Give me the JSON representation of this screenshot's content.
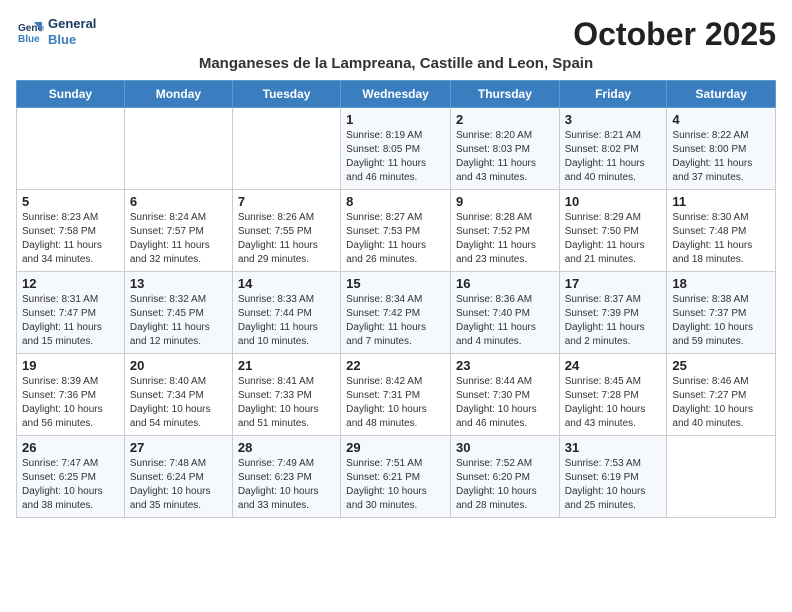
{
  "logo": {
    "line1": "General",
    "line2": "Blue"
  },
  "title": "October 2025",
  "subtitle": "Manganeses de la Lampreana, Castille and Leon, Spain",
  "weekdays": [
    "Sunday",
    "Monday",
    "Tuesday",
    "Wednesday",
    "Thursday",
    "Friday",
    "Saturday"
  ],
  "weeks": [
    [
      {
        "day": "",
        "info": ""
      },
      {
        "day": "",
        "info": ""
      },
      {
        "day": "",
        "info": ""
      },
      {
        "day": "1",
        "info": "Sunrise: 8:19 AM\nSunset: 8:05 PM\nDaylight: 11 hours\nand 46 minutes."
      },
      {
        "day": "2",
        "info": "Sunrise: 8:20 AM\nSunset: 8:03 PM\nDaylight: 11 hours\nand 43 minutes."
      },
      {
        "day": "3",
        "info": "Sunrise: 8:21 AM\nSunset: 8:02 PM\nDaylight: 11 hours\nand 40 minutes."
      },
      {
        "day": "4",
        "info": "Sunrise: 8:22 AM\nSunset: 8:00 PM\nDaylight: 11 hours\nand 37 minutes."
      }
    ],
    [
      {
        "day": "5",
        "info": "Sunrise: 8:23 AM\nSunset: 7:58 PM\nDaylight: 11 hours\nand 34 minutes."
      },
      {
        "day": "6",
        "info": "Sunrise: 8:24 AM\nSunset: 7:57 PM\nDaylight: 11 hours\nand 32 minutes."
      },
      {
        "day": "7",
        "info": "Sunrise: 8:26 AM\nSunset: 7:55 PM\nDaylight: 11 hours\nand 29 minutes."
      },
      {
        "day": "8",
        "info": "Sunrise: 8:27 AM\nSunset: 7:53 PM\nDaylight: 11 hours\nand 26 minutes."
      },
      {
        "day": "9",
        "info": "Sunrise: 8:28 AM\nSunset: 7:52 PM\nDaylight: 11 hours\nand 23 minutes."
      },
      {
        "day": "10",
        "info": "Sunrise: 8:29 AM\nSunset: 7:50 PM\nDaylight: 11 hours\nand 21 minutes."
      },
      {
        "day": "11",
        "info": "Sunrise: 8:30 AM\nSunset: 7:48 PM\nDaylight: 11 hours\nand 18 minutes."
      }
    ],
    [
      {
        "day": "12",
        "info": "Sunrise: 8:31 AM\nSunset: 7:47 PM\nDaylight: 11 hours\nand 15 minutes."
      },
      {
        "day": "13",
        "info": "Sunrise: 8:32 AM\nSunset: 7:45 PM\nDaylight: 11 hours\nand 12 minutes."
      },
      {
        "day": "14",
        "info": "Sunrise: 8:33 AM\nSunset: 7:44 PM\nDaylight: 11 hours\nand 10 minutes."
      },
      {
        "day": "15",
        "info": "Sunrise: 8:34 AM\nSunset: 7:42 PM\nDaylight: 11 hours\nand 7 minutes."
      },
      {
        "day": "16",
        "info": "Sunrise: 8:36 AM\nSunset: 7:40 PM\nDaylight: 11 hours\nand 4 minutes."
      },
      {
        "day": "17",
        "info": "Sunrise: 8:37 AM\nSunset: 7:39 PM\nDaylight: 11 hours\nand 2 minutes."
      },
      {
        "day": "18",
        "info": "Sunrise: 8:38 AM\nSunset: 7:37 PM\nDaylight: 10 hours\nand 59 minutes."
      }
    ],
    [
      {
        "day": "19",
        "info": "Sunrise: 8:39 AM\nSunset: 7:36 PM\nDaylight: 10 hours\nand 56 minutes."
      },
      {
        "day": "20",
        "info": "Sunrise: 8:40 AM\nSunset: 7:34 PM\nDaylight: 10 hours\nand 54 minutes."
      },
      {
        "day": "21",
        "info": "Sunrise: 8:41 AM\nSunset: 7:33 PM\nDaylight: 10 hours\nand 51 minutes."
      },
      {
        "day": "22",
        "info": "Sunrise: 8:42 AM\nSunset: 7:31 PM\nDaylight: 10 hours\nand 48 minutes."
      },
      {
        "day": "23",
        "info": "Sunrise: 8:44 AM\nSunset: 7:30 PM\nDaylight: 10 hours\nand 46 minutes."
      },
      {
        "day": "24",
        "info": "Sunrise: 8:45 AM\nSunset: 7:28 PM\nDaylight: 10 hours\nand 43 minutes."
      },
      {
        "day": "25",
        "info": "Sunrise: 8:46 AM\nSunset: 7:27 PM\nDaylight: 10 hours\nand 40 minutes."
      }
    ],
    [
      {
        "day": "26",
        "info": "Sunrise: 7:47 AM\nSunset: 6:25 PM\nDaylight: 10 hours\nand 38 minutes."
      },
      {
        "day": "27",
        "info": "Sunrise: 7:48 AM\nSunset: 6:24 PM\nDaylight: 10 hours\nand 35 minutes."
      },
      {
        "day": "28",
        "info": "Sunrise: 7:49 AM\nSunset: 6:23 PM\nDaylight: 10 hours\nand 33 minutes."
      },
      {
        "day": "29",
        "info": "Sunrise: 7:51 AM\nSunset: 6:21 PM\nDaylight: 10 hours\nand 30 minutes."
      },
      {
        "day": "30",
        "info": "Sunrise: 7:52 AM\nSunset: 6:20 PM\nDaylight: 10 hours\nand 28 minutes."
      },
      {
        "day": "31",
        "info": "Sunrise: 7:53 AM\nSunset: 6:19 PM\nDaylight: 10 hours\nand 25 minutes."
      },
      {
        "day": "",
        "info": ""
      }
    ]
  ]
}
